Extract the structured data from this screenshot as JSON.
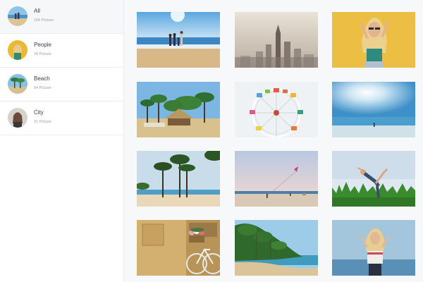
{
  "sidebar": {
    "albums": [
      {
        "name": "All",
        "count": "156 Picture",
        "icon": "beach-people-icon",
        "active": true
      },
      {
        "name": "People",
        "count": "28 Picture",
        "icon": "person-portrait-icon",
        "active": false
      },
      {
        "name": "Beach",
        "count": "64 Picture",
        "icon": "palm-beach-icon",
        "active": false
      },
      {
        "name": "City",
        "count": "31 Picture",
        "icon": "city-portrait-icon",
        "active": false
      }
    ]
  },
  "gallery": {
    "photos": [
      {
        "subject": "couple-on-beach"
      },
      {
        "subject": "city-skyline-fog"
      },
      {
        "subject": "woman-yellow-wall"
      },
      {
        "subject": "palm-resort-hut"
      },
      {
        "subject": "ferris-wheel"
      },
      {
        "subject": "ocean-sunburst"
      },
      {
        "subject": "palm-trees-beach"
      },
      {
        "subject": "beach-kite"
      },
      {
        "subject": "woman-yoga-grass"
      },
      {
        "subject": "bicycle-wall"
      },
      {
        "subject": "tropical-coast"
      },
      {
        "subject": "woman-sea-portrait"
      }
    ]
  }
}
